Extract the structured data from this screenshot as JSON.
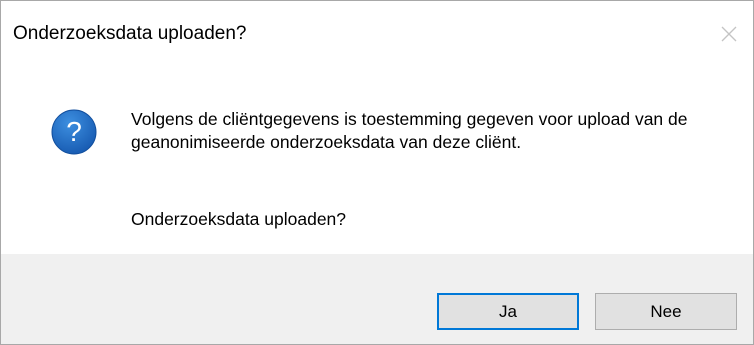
{
  "dialog": {
    "title": "Onderzoeksdata uploaden?",
    "close_icon": "close-icon",
    "icon": "question-icon",
    "message": "Volgens de cliëntgegevens is toestemming gegeven voor upload van de geanonimiseerde onderzoeksdata van deze cliënt.",
    "question": "Onderzoeksdata uploaden?",
    "buttons": {
      "yes_label": "Ja",
      "no_label": "Nee"
    }
  },
  "colors": {
    "icon_blue": "#1f6fc5",
    "default_button_border": "#0078d7",
    "footer_bg": "#f0f0f0",
    "button_bg": "#e1e1e1"
  }
}
